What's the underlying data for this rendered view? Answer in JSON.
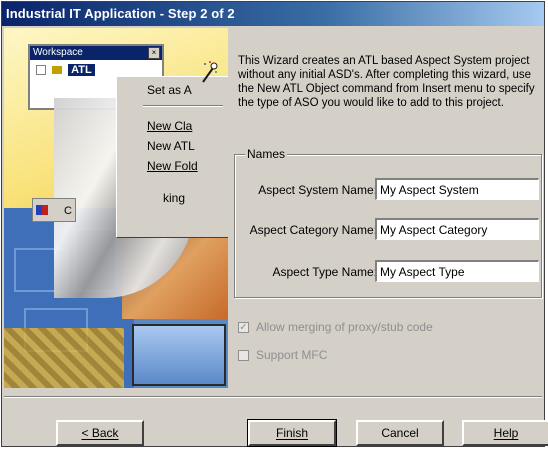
{
  "window": {
    "title": "Industrial IT Application - Step 2 of 2"
  },
  "illustration": {
    "workspace_title": "Workspace",
    "tree_node": "ATL",
    "close_glyph": "×",
    "menu_items": [
      "Set as A",
      "New Cla",
      "New ATL",
      "New Fold",
      "king"
    ],
    "toolbar_chip_text": "C"
  },
  "description": "This Wizard creates an ATL based Aspect System project without any initial ASD's. After completing this wizard, use the New ATL Object command from Insert menu to specify the type of ASO you would like to add to this project.",
  "names_group": {
    "legend": "Names",
    "fields": [
      {
        "label": "Aspect System Name:",
        "value": "My Aspect System"
      },
      {
        "label": "Aspect Category Name:",
        "value": "My Aspect Category"
      },
      {
        "label": "Aspect Type Name:",
        "value": "My Aspect Type"
      }
    ]
  },
  "options": [
    {
      "label": "Allow merging of proxy/stub code",
      "checked": true,
      "enabled": false,
      "mark": "✓"
    },
    {
      "label": "Support MFC",
      "checked": false,
      "enabled": false,
      "mark": ""
    }
  ],
  "buttons": {
    "back": "< Back",
    "finish": "Finish",
    "cancel": "Cancel",
    "help": "Help"
  }
}
